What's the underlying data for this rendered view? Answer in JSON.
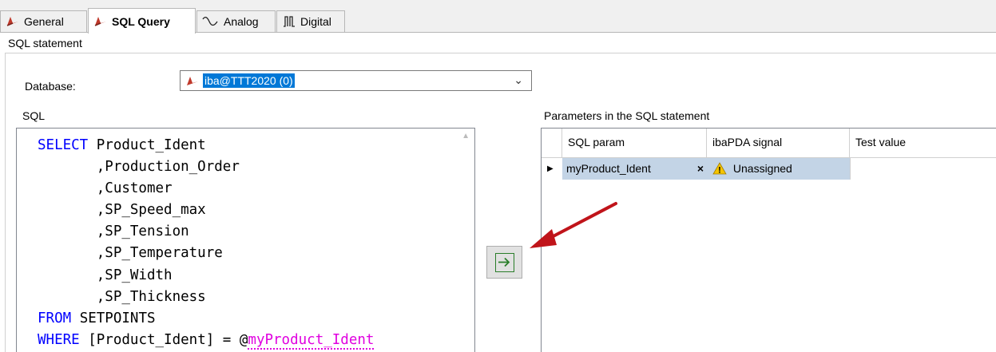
{
  "tabs": [
    {
      "label": "General",
      "icon": "general-icon"
    },
    {
      "label": "SQL Query",
      "icon": "sql-query-icon",
      "active": true
    },
    {
      "label": "Analog",
      "icon": "analog-wave-icon"
    },
    {
      "label": "Digital",
      "icon": "digital-signal-icon"
    }
  ],
  "group": {
    "title": "SQL statement"
  },
  "database": {
    "label": "Database:",
    "value": "iba@TTT2020 (0)"
  },
  "sql": {
    "label": "SQL",
    "lines": [
      {
        "kw": "SELECT",
        "text": " Product_Ident"
      },
      {
        "kw": "",
        "text": "       ,Production_Order"
      },
      {
        "kw": "",
        "text": "       ,Customer"
      },
      {
        "kw": "",
        "text": "       ,SP_Speed_max"
      },
      {
        "kw": "",
        "text": "       ,SP_Tension"
      },
      {
        "kw": "",
        "text": "       ,SP_Temperature"
      },
      {
        "kw": "",
        "text": "       ,SP_Width"
      },
      {
        "kw": "",
        "text": "       ,SP_Thickness"
      },
      {
        "kw": "FROM",
        "text": " SETPOINTS"
      },
      {
        "kw": "WHERE",
        "text": " [Product_Ident] = @",
        "param": "myProduct_Ident"
      }
    ]
  },
  "params": {
    "label": "Parameters in the SQL statement",
    "columns": [
      "SQL param",
      "ibaPDA signal",
      "Test value"
    ],
    "rows": [
      {
        "sql_param": "myProduct_Ident",
        "signal": "Unassigned",
        "test_value": ""
      }
    ]
  },
  "colors": {
    "keyword": "#0000ff",
    "param": "#e000e0",
    "selection": "#0078d7",
    "annotation_arrow": "#c0141a"
  }
}
